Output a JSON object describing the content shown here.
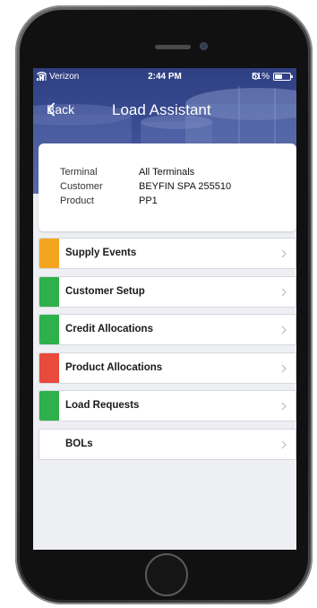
{
  "status_bar": {
    "carrier": "Verizon",
    "time": "2:44 PM",
    "battery": "51%",
    "battery_level": 0.51,
    "icons": [
      "signal-icon",
      "wifi-icon",
      "alarm-icon",
      "battery-icon"
    ]
  },
  "nav": {
    "back_label": "Back",
    "title": "Load Assistant"
  },
  "info": {
    "rows": [
      {
        "label": "Terminal",
        "value": "All Terminals"
      },
      {
        "label": "Customer",
        "value": "BEYFIN SPA 255510"
      },
      {
        "label": "Product",
        "value": "PP1"
      }
    ]
  },
  "menu": {
    "items": [
      {
        "label": "Supply Events",
        "accent": "#f4a520"
      },
      {
        "label": "Customer Setup",
        "accent": "#2eb04a"
      },
      {
        "label": "Credit Allocations",
        "accent": "#2eb04a"
      },
      {
        "label": "Product Allocations",
        "accent": "#e84a3c"
      },
      {
        "label": "Load Requests",
        "accent": "#2eb04a"
      },
      {
        "label": "BOLs",
        "accent": ""
      }
    ]
  },
  "colors": {
    "header": "#3b4d95",
    "background": "#eeeff3"
  }
}
